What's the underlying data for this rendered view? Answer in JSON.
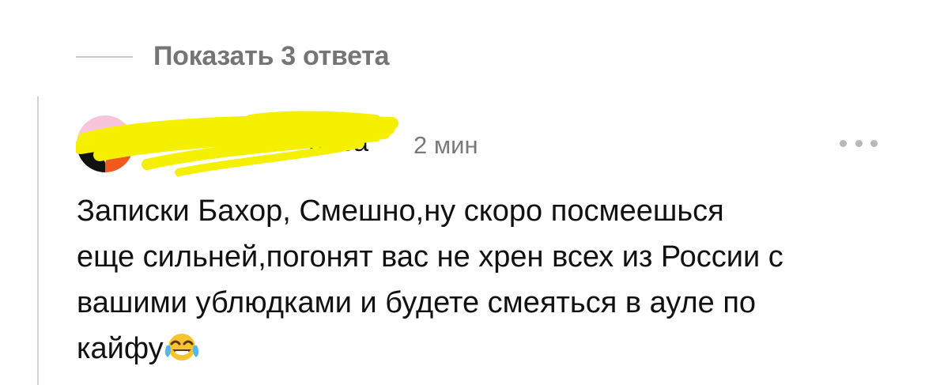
{
  "replies": {
    "show_label": "Показать 3 ответа"
  },
  "comment": {
    "author_visible": "пова",
    "time": "2 мин",
    "text": "Записки Бахор, Смешно,ну скоро посмеешься\nеще сильней,погонят вас не хрен всех из России с\nвашими ублюдками и будете смеяться в ауле по\nкайфу",
    "emoji": "face-with-tears-of-joy",
    "more_icon": "more-dots-icon"
  },
  "colors": {
    "scribble": "#f4f000",
    "muted_text": "#7a7a7a",
    "thread_line": "#d2d2d2"
  }
}
